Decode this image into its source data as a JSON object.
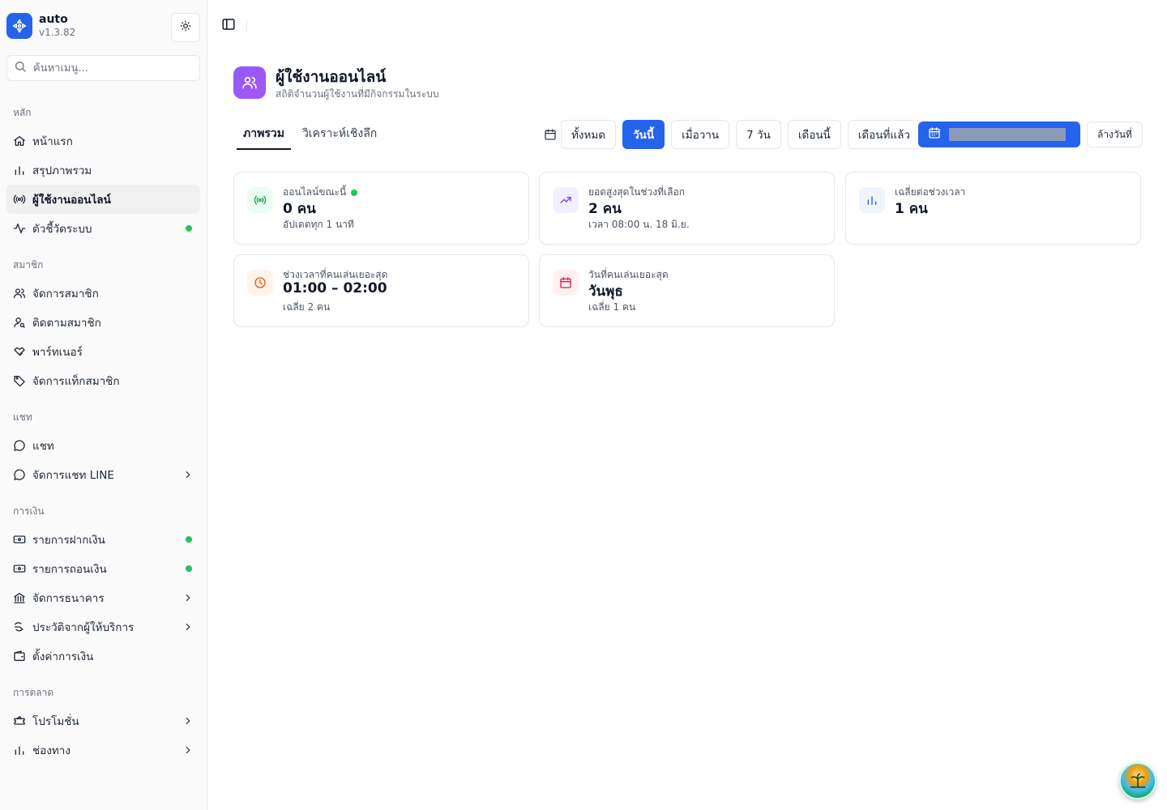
{
  "brand": {
    "name": "auto",
    "version": "v1.3.82"
  },
  "search": {
    "placeholder": "ค้นหาเมนู..."
  },
  "nav": {
    "groups": [
      {
        "label": "หลัก",
        "items": [
          {
            "label": "หน้าแรก",
            "icon": "home-icon"
          },
          {
            "label": "สรุปภาพรวม",
            "icon": "bar-chart-icon"
          },
          {
            "label": "ผู้ใช้งานออนไลน์",
            "icon": "radio-icon",
            "active": true
          },
          {
            "label": "ตัวชี้วัดระบบ",
            "icon": "activity-icon",
            "dot": true
          }
        ]
      },
      {
        "label": "สมาชิก",
        "items": [
          {
            "label": "จัดการสมาชิก",
            "icon": "users-icon"
          },
          {
            "label": "ติดตามสมาชิก",
            "icon": "user-search-icon"
          },
          {
            "label": "พาร์ทเนอร์",
            "icon": "handshake-icon"
          },
          {
            "label": "จัดการแท็กสมาชิก",
            "icon": "tag-icon"
          }
        ]
      },
      {
        "label": "แชท",
        "items": [
          {
            "label": "แชท",
            "icon": "message-circle-icon"
          },
          {
            "label": "จัดการแชท LINE",
            "icon": "message-circle-icon",
            "chevron": true
          }
        ]
      },
      {
        "label": "การเงิน",
        "items": [
          {
            "label": "รายการฝากเงิน",
            "icon": "deposit-icon",
            "dot": true
          },
          {
            "label": "รายการถอนเงิน",
            "icon": "withdraw-icon",
            "dot": true
          },
          {
            "label": "จัดการธนาคาร",
            "icon": "bank-icon",
            "chevron": true
          },
          {
            "label": "ประวัติจากผู้ให้บริการ",
            "icon": "history-icon",
            "chevron": true
          },
          {
            "label": "ตั้งค่าการเงิน",
            "icon": "wallet-icon"
          }
        ]
      },
      {
        "label": "การตลาด",
        "items": [
          {
            "label": "โปรโมชั่น",
            "icon": "ticket-icon",
            "chevron": true
          },
          {
            "label": "ช่องทาง",
            "icon": "bar-chart-icon",
            "chevron": true
          }
        ]
      }
    ]
  },
  "page": {
    "title": "ผู้ใช้งานออนไลน์",
    "subtitle": "สถิติจำนวนผู้ใช้งานที่มีกิจกรรมในระบบ",
    "tabs": [
      {
        "label": "ภาพรวม",
        "active": true
      },
      {
        "label": "วิเคราะห์เชิงลึก"
      }
    ],
    "filters": [
      {
        "label": "ทั้งหมด"
      },
      {
        "label": "วันนี้",
        "active": true
      },
      {
        "label": "เมื่อวาน"
      },
      {
        "label": "7 วัน"
      },
      {
        "label": "เดือนนี้"
      },
      {
        "label": "เดือนที่แล้ว"
      }
    ],
    "clear_label": "ล้างวันที่"
  },
  "cards": [
    {
      "label": "ออนไลน์ขณะนี้",
      "value": "0 คน",
      "note": "อัปเดตทุก 1 นาที",
      "icon": "radio-icon",
      "color": "#16a34a",
      "bg": "#ecfdf3",
      "live": true
    },
    {
      "label": "ยอดสูงสุดในช่วงที่เลือก",
      "value": "2 คน",
      "note": "เวลา 08:00 น. 18 มิ.ย.",
      "icon": "trending-up-icon",
      "color": "#7c3aed",
      "bg": "#f3efff"
    },
    {
      "label": "เฉลี่ยต่อช่วงเวลา",
      "value": "1 คน",
      "note": "",
      "icon": "bar-chart-icon",
      "color": "#2563eb",
      "bg": "#eff4ff"
    },
    {
      "label": "ช่วงเวลาที่คนเล่นเยอะสุด",
      "value": "01:00 – 02:00",
      "note": "เฉลี่ย 2 คน",
      "icon": "clock-icon",
      "color": "#ea580c",
      "bg": "#fff4ea"
    },
    {
      "label": "วันที่คนเล่นเยอะสุด",
      "value": "วันพุธ",
      "note": "เฉลี่ย 1 คน",
      "icon": "calendar-icon",
      "color": "#e11d48",
      "bg": "#fff0f2"
    }
  ]
}
